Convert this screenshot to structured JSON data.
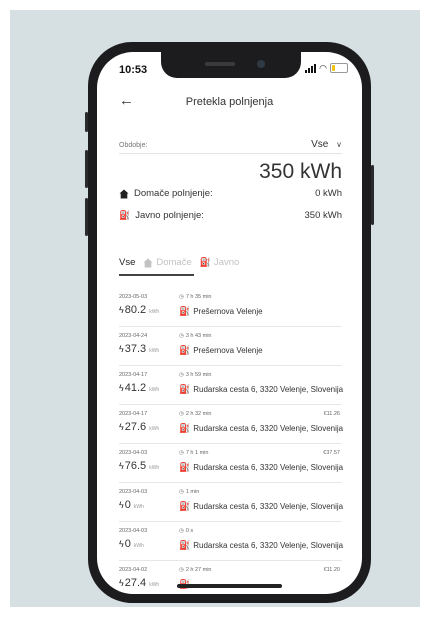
{
  "status": {
    "time": "10:53"
  },
  "header": {
    "title": "Pretekla polnjenja"
  },
  "period": {
    "label": "Obdobje:",
    "value": "Vse"
  },
  "summary": {
    "total": "350 kWh",
    "home_label": "Domače polnjenje:",
    "home_value": "0 kWh",
    "public_label": "Javno polnjenje:",
    "public_value": "350 kWh"
  },
  "tabs": [
    {
      "label": "Vse",
      "active": true
    },
    {
      "label": "Domače",
      "active": false
    },
    {
      "label": "Javno",
      "active": false
    }
  ],
  "energy_unit": "kWh",
  "sessions": [
    {
      "date": "2023-05-03",
      "energy": "80.2",
      "duration": "7 h 35 min",
      "cost": "",
      "location": "Prešernova Velenje"
    },
    {
      "date": "2023-04-24",
      "energy": "37.3",
      "duration": "3 h 43 min",
      "cost": "",
      "location": "Prešernova Velenje"
    },
    {
      "date": "2023-04-17",
      "energy": "41.2",
      "duration": "3 h 59 min",
      "cost": "",
      "location": "Rudarska cesta 6, 3320 Velenje, Slovenija"
    },
    {
      "date": "2023-04-17",
      "energy": "27.6",
      "duration": "2 h 32 min",
      "cost": "€11.26",
      "location": "Rudarska cesta 6, 3320 Velenje, Slovenija"
    },
    {
      "date": "2023-04-03",
      "energy": "76.5",
      "duration": "7 h 1 min",
      "cost": "€37.57",
      "location": "Rudarska cesta 6, 3320 Velenje, Slovenija"
    },
    {
      "date": "2023-04-03",
      "energy": "0",
      "duration": "1 min",
      "cost": "",
      "location": "Rudarska cesta 6, 3320 Velenje, Slovenija"
    },
    {
      "date": "2023-04-03",
      "energy": "0",
      "duration": "0 s",
      "cost": "",
      "location": "Rudarska cesta 6, 3320 Velenje, Slovenija"
    },
    {
      "date": "2023-04-02",
      "energy": "27.4",
      "duration": "2 h 27 min",
      "cost": "€11.20",
      "location": ""
    }
  ]
}
